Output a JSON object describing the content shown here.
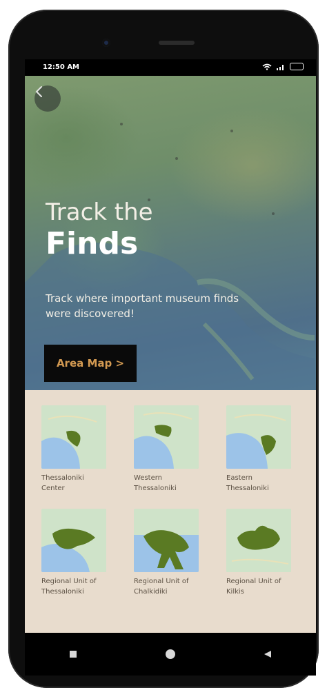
{
  "status": {
    "time": "12:50 AM",
    "icons": [
      "notification-icon",
      "wifi-icon",
      "signal-icon",
      "battery-icon"
    ]
  },
  "hero": {
    "title_line1": "Track the",
    "title_line2": "Finds",
    "subtitle": "Track where important museum finds were discovered!",
    "button_label": "Area Map >"
  },
  "regions": [
    {
      "label": "Thessaloniki Center"
    },
    {
      "label": "Western Thessaloniki"
    },
    {
      "label": "Eastern Thessaloniki"
    },
    {
      "label": "Regional Unit of Thessaloniki"
    },
    {
      "label": "Regional Unit of Chalkidiki"
    },
    {
      "label": "Regional Unit of Kilkis"
    }
  ],
  "colors": {
    "accent": "#d39a52",
    "region_fill": "#5a7a23",
    "background": "#e8dccd"
  },
  "nav": [
    "square-icon",
    "circle-icon",
    "triangle-icon"
  ]
}
